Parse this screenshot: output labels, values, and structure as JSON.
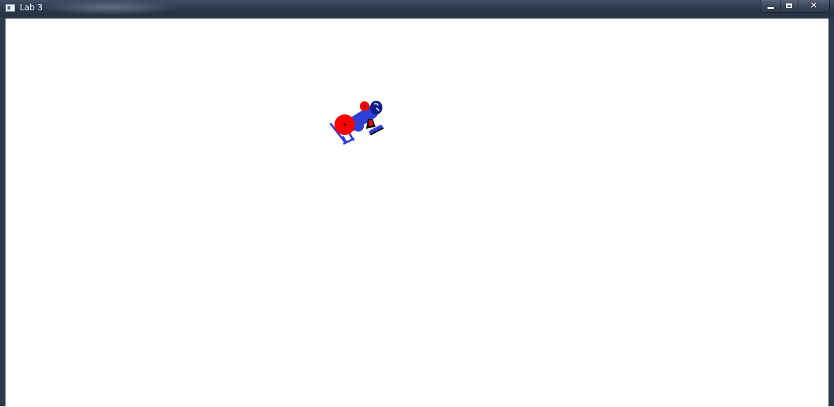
{
  "window": {
    "title": "Lab 3",
    "icon": "app-window-icon",
    "caption_buttons": [
      {
        "name": "minimize",
        "icon": "minimize-icon"
      },
      {
        "name": "maximize",
        "icon": "maximize-icon"
      },
      {
        "name": "close",
        "icon": "close-icon",
        "glyph": "✕"
      }
    ]
  },
  "canvas": {
    "background": "#ffffff",
    "figure": {
      "description_colors": {
        "body": "#2e3fd6",
        "wheel": "#ff0000",
        "dark": "#0c1a8a",
        "black": "#000000"
      }
    }
  }
}
